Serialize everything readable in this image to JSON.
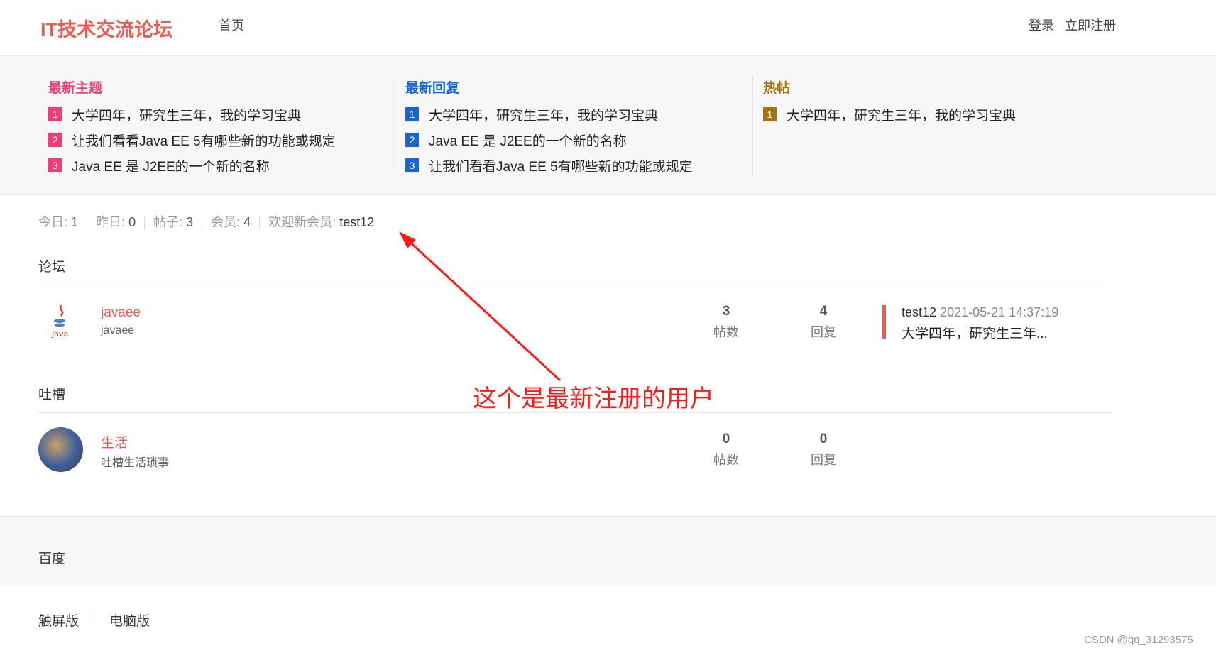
{
  "header": {
    "logo": "IT技术交流论坛",
    "nav_home": "首页",
    "login": "登录",
    "register": "立即注册"
  },
  "panels": [
    {
      "title": "最新主题",
      "color": "#ee3f73",
      "items": [
        {
          "n": "1",
          "t": "大学四年，研究生三年，我的学习宝典"
        },
        {
          "n": "2",
          "t": "让我们看看Java EE 5有哪些新的功能或规定"
        },
        {
          "n": "3",
          "t": "Java EE 是 J2EE的一个新的名称"
        }
      ]
    },
    {
      "title": "最新回复",
      "color": "#1565d8",
      "items": [
        {
          "n": "1",
          "t": "大学四年，研究生三年，我的学习宝典"
        },
        {
          "n": "2",
          "t": "Java EE 是 J2EE的一个新的名称"
        },
        {
          "n": "3",
          "t": "让我们看看Java EE 5有哪些新的功能或规定"
        }
      ]
    },
    {
      "title": "热帖",
      "color": "#a8700f",
      "items": [
        {
          "n": "1",
          "t": "大学四年，研究生三年，我的学习宝典"
        }
      ]
    }
  ],
  "stats": {
    "today_label": "今日:",
    "today": "1",
    "yesterday_label": "昨日:",
    "yesterday": "0",
    "posts_label": "帖子:",
    "posts": "3",
    "members_label": "会员:",
    "members": "4",
    "welcome_label": "欢迎新会员:",
    "newest": "test12"
  },
  "sections": [
    {
      "title": "论坛",
      "forum": {
        "name": "javaee",
        "desc": "javaee",
        "posts": "3",
        "posts_label": "帖数",
        "replies": "4",
        "replies_label": "回复",
        "last_user": "test12",
        "last_time": "2021-05-21 14:37:19",
        "last_title": "大学四年，研究生三年..."
      }
    },
    {
      "title": "吐槽",
      "forum": {
        "name": "生活",
        "desc": "吐槽生活琐事",
        "posts": "0",
        "posts_label": "帖数",
        "replies": "0",
        "replies_label": "回复"
      }
    }
  ],
  "annotation": "这个是最新注册的用户",
  "footer": {
    "link": "百度",
    "touch": "触屏版",
    "pc": "电脑版"
  },
  "watermark": "CSDN @qq_31293575"
}
